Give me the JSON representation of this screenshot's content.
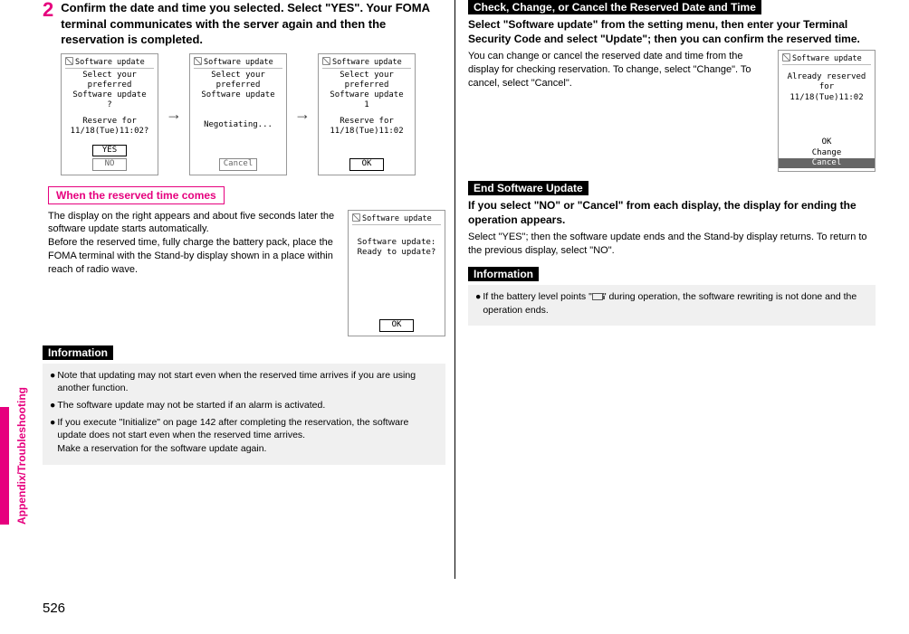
{
  "sideTab": "Appendix/Troubleshooting",
  "pageNumber": "526",
  "left": {
    "stepNum": "2",
    "stepText": "Confirm the date and time you selected. Select \"YES\". Your FOMA terminal communicates with the server again and then the reservation is completed.",
    "screen1": {
      "title": "Software update",
      "line1": "Select your preferred",
      "line2": "Software update",
      "line3": "?",
      "line4": "Reserve for",
      "line5": "11/18(Tue)11:02?",
      "btnYes": "YES",
      "btnNo": "NO"
    },
    "screen2": {
      "title": "Software update",
      "line1": "Select your preferred",
      "line2": "Software update",
      "line3": "Negotiating...",
      "btn": "Cancel"
    },
    "screen3": {
      "title": "Software update",
      "line1": "Select your preferred",
      "line2": "Software update",
      "line3": "1",
      "line4": "Reserve for",
      "line5": "11/18(Tue)11:02",
      "btn": "OK"
    },
    "pinkHead": "When the reserved time comes",
    "paraText": "The display on the right appears and about five seconds later the software update starts automatically.\nBefore the reserved time, fully charge the battery pack, place the FOMA terminal with the Stand-by display shown in a place within reach of radio wave.",
    "screenReady": {
      "title": "Software update",
      "line": "Software update:\nReady to update?",
      "btn": "OK"
    },
    "infoLabel": "Information",
    "info": [
      "Note that updating may not start even when the reserved time arrives if you are using another function.",
      "The software update may not be started if an alarm is activated.",
      "If you execute \"Initialize\" on page 142 after completing the reservation, the software update does not start even when the reserved time arrives.\nMake a reservation for the software update again."
    ]
  },
  "right": {
    "bar1": "Check, Change, or Cancel the Reserved Date and Time",
    "bold1": "Select \"Software update\" from the setting menu, then enter your Terminal Security Code and select \"Update\"; then you can confirm the reserved time.",
    "para1": "You can change or cancel the reserved date and time from the display for checking reservation. To change, select \"Change\". To cancel, select \"Cancel\".",
    "screenReserved": {
      "title": "Software update",
      "line1": "Already reserved for",
      "line2": "11/18(Tue)11:02",
      "opt1": "OK",
      "opt2": "Change",
      "opt3": "Cancel"
    },
    "bar2": "End Software Update",
    "bold2": "If you select \"NO\" or \"Cancel\" from each display, the display for ending the operation appears.",
    "para2": "Select \"YES\"; then the software update ends and the Stand-by display returns. To return to the previous display, select \"NO\".",
    "infoLabel": "Information",
    "info2a": "If the battery level points \"",
    "info2b": "\" during operation, the software rewriting is not done and the operation ends."
  }
}
